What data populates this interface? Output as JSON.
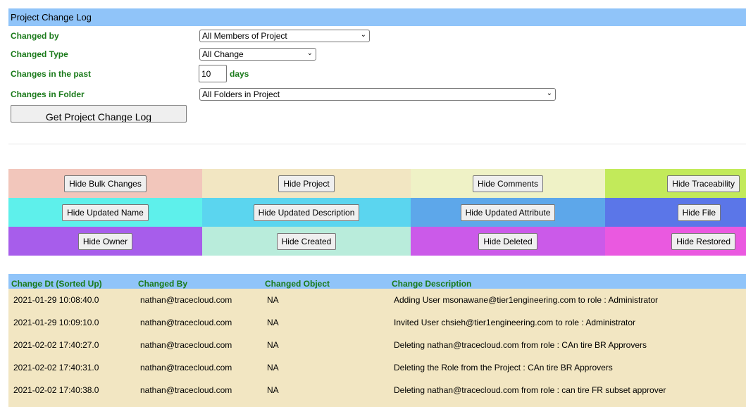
{
  "header": {
    "title": "Project Change Log"
  },
  "form": {
    "changed_by": {
      "label": "Changed by",
      "value": "All Members of Project"
    },
    "changed_type": {
      "label": "Changed Type",
      "value": "All Change"
    },
    "changes_past": {
      "label": "Changes in the past",
      "value": "10",
      "unit": "days"
    },
    "changes_folder": {
      "label": "Changes in Folder",
      "value": "All Folders in Project"
    },
    "submit_label": "Get Project Change Log"
  },
  "filters": [
    {
      "label": "Hide Bulk Changes",
      "color": "#f2c6bb"
    },
    {
      "label": "Hide Project",
      "color": "#f2e6c2"
    },
    {
      "label": "Hide Comments",
      "color": "#eff2c6"
    },
    {
      "label": "Hide Traceability",
      "color": "#c2ea5a"
    },
    {
      "label": "Hide Updated Name",
      "color": "#5ef0eb"
    },
    {
      "label": "Hide Updated Description",
      "color": "#5bd5ef"
    },
    {
      "label": "Hide Updated Attribute",
      "color": "#5da7ea"
    },
    {
      "label": "Hide File",
      "color": "#5b76e8"
    },
    {
      "label": "Hide Owner",
      "color": "#a75deb"
    },
    {
      "label": "Hide Created",
      "color": "#b9ecdb"
    },
    {
      "label": "Hide Deleted",
      "color": "#cb5ae9"
    },
    {
      "label": "Hide Restored",
      "color": "#ea59e0"
    }
  ],
  "log": {
    "columns": [
      "Change Dt (Sorted Up)",
      "Changed By",
      "Changed Object",
      "Change Description"
    ],
    "rows": [
      [
        "2021-01-29 10:08:40.0",
        "nathan@tracecloud.com",
        "NA",
        "Adding User msonawane@tier1engineering.com to role : Administrator"
      ],
      [
        "2021-01-29 10:09:10.0",
        "nathan@tracecloud.com",
        "NA",
        "Invited User chsieh@tier1engineering.com to role : Administrator"
      ],
      [
        "2021-02-02 17:40:27.0",
        "nathan@tracecloud.com",
        "NA",
        "Deleting nathan@tracecloud.com from role : CAn tire BR Approvers"
      ],
      [
        "2021-02-02 17:40:31.0",
        "nathan@tracecloud.com",
        "NA",
        "Deleting the Role from the Project : CAn tire BR Approvers"
      ],
      [
        "2021-02-02 17:40:38.0",
        "nathan@tracecloud.com",
        "NA",
        "Deleting nathan@tracecloud.com from role : can tire FR subset approver"
      ]
    ]
  }
}
